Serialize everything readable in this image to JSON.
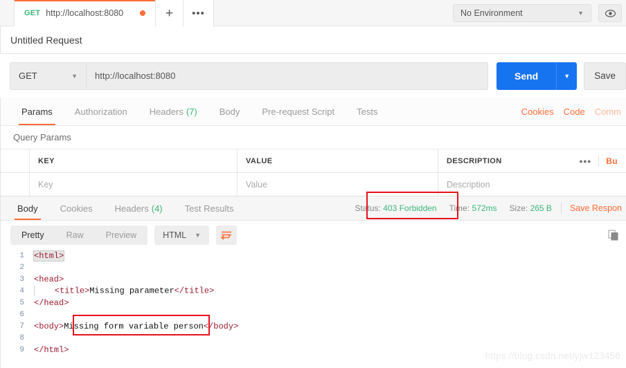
{
  "tabbar": {
    "tab": {
      "method": "GET",
      "url": "http://localhost:8080",
      "unsaved": ""
    },
    "new_tab_label": "+",
    "more_label": "•••",
    "environment": {
      "selected": "No Environment",
      "caret": "▼"
    },
    "eye_icon": "👁"
  },
  "request": {
    "name": "Untitled Request",
    "method": "GET",
    "method_caret": "▼",
    "url": "http://localhost:8080",
    "send_label": "Send",
    "send_caret": "▼",
    "save_label": "Save",
    "tabs": [
      {
        "label": "Params",
        "count": ""
      },
      {
        "label": "Authorization",
        "count": ""
      },
      {
        "label": "Headers",
        "count": "(7)"
      },
      {
        "label": "Body",
        "count": ""
      },
      {
        "label": "Pre-request Script",
        "count": ""
      },
      {
        "label": "Tests",
        "count": ""
      }
    ],
    "links": [
      {
        "label": "Cookies"
      },
      {
        "label": "Code"
      },
      {
        "label": "Comm"
      }
    ]
  },
  "params": {
    "title": "Query Params",
    "columns": [
      "KEY",
      "VALUE",
      "DESCRIPTION"
    ],
    "rows": [
      {
        "key": "Key",
        "value": "Value",
        "description": "Description"
      }
    ],
    "dots_label": "•••",
    "bulk_edit_label": "Bu"
  },
  "response": {
    "tabs": [
      {
        "label": "Body",
        "count": ""
      },
      {
        "label": "Cookies",
        "count": ""
      },
      {
        "label": "Headers",
        "count": "(4)"
      },
      {
        "label": "Test Results",
        "count": ""
      }
    ],
    "status_label": "Status:",
    "status_value": "403 Forbidden",
    "time_label": "Time:",
    "time_value": "572ms",
    "size_label": "Size:",
    "size_value": "265 B",
    "save_response_label": "Save Respon",
    "view_modes": [
      "Pretty",
      "Raw",
      "Preview"
    ],
    "active_view_mode": "Pretty",
    "format": "HTML",
    "format_caret": "▼",
    "body_lines": [
      {
        "n": "1",
        "text": "<html>"
      },
      {
        "n": "2",
        "text": ""
      },
      {
        "n": "3",
        "text": "<head>"
      },
      {
        "n": "4",
        "text": "    <title>Missing parameter</title>"
      },
      {
        "n": "5",
        "text": "</head>"
      },
      {
        "n": "6",
        "text": ""
      },
      {
        "n": "7",
        "text": "<body>Missing form variable person</body>"
      },
      {
        "n": "8",
        "text": ""
      },
      {
        "n": "9",
        "text": "</html>"
      }
    ]
  },
  "annotations": {
    "status_box": "403 Forbidden",
    "body_box": "Missing form variable person"
  },
  "watermark": "https://blog.csdn.net/yjw123456",
  "colors": {
    "accent_orange": "#ff6c37",
    "send_blue": "#1774f0",
    "status_green": "#3ab67a",
    "annotation_red": "#e8111b",
    "tag_maroon": "#9b1b30"
  }
}
